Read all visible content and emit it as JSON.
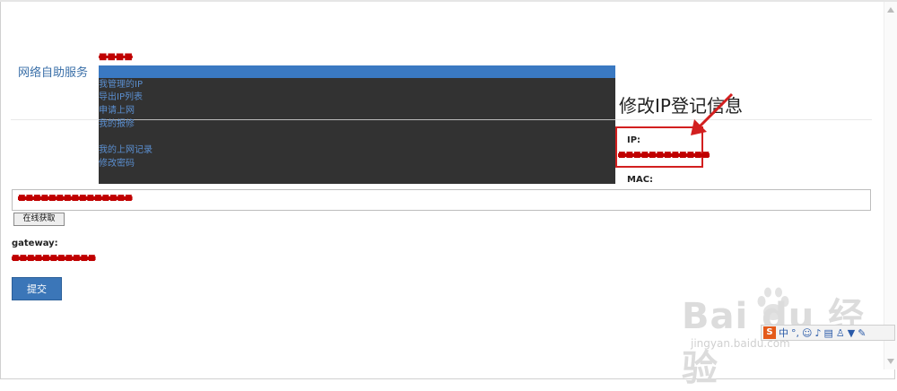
{
  "header": {
    "brand": "网络自助服务",
    "username_redacted": "■■■■"
  },
  "menu": {
    "items": [
      {
        "label": "我管理的IP"
      },
      {
        "label": "导出IP列表"
      },
      {
        "label": "申请上网"
      },
      {
        "label": "我的报修"
      },
      {
        "label": "我的上网记录"
      },
      {
        "label": "修改密码"
      }
    ]
  },
  "page": {
    "title": "修改IP登记信息"
  },
  "form": {
    "ip_label": "IP:",
    "ip_value_redacted": "■■■■■■■■■■■■",
    "mac_label": "MAC:",
    "mac_value_redacted": "■■■■■■■■■■■■■■■",
    "fetch_button": "在线获取",
    "gateway_label": "gateway:",
    "gateway_value_redacted": "■■■■■■■■■■■",
    "submit_button": "提交"
  },
  "watermark": {
    "main": "Bai du 经验",
    "sub": "jingyan.baidu.com"
  },
  "ime": {
    "mode": "中",
    "brand": "S"
  },
  "colors": {
    "accent": "#3b76b8",
    "menu_bg": "#323232",
    "annotation": "#d21f1f"
  }
}
